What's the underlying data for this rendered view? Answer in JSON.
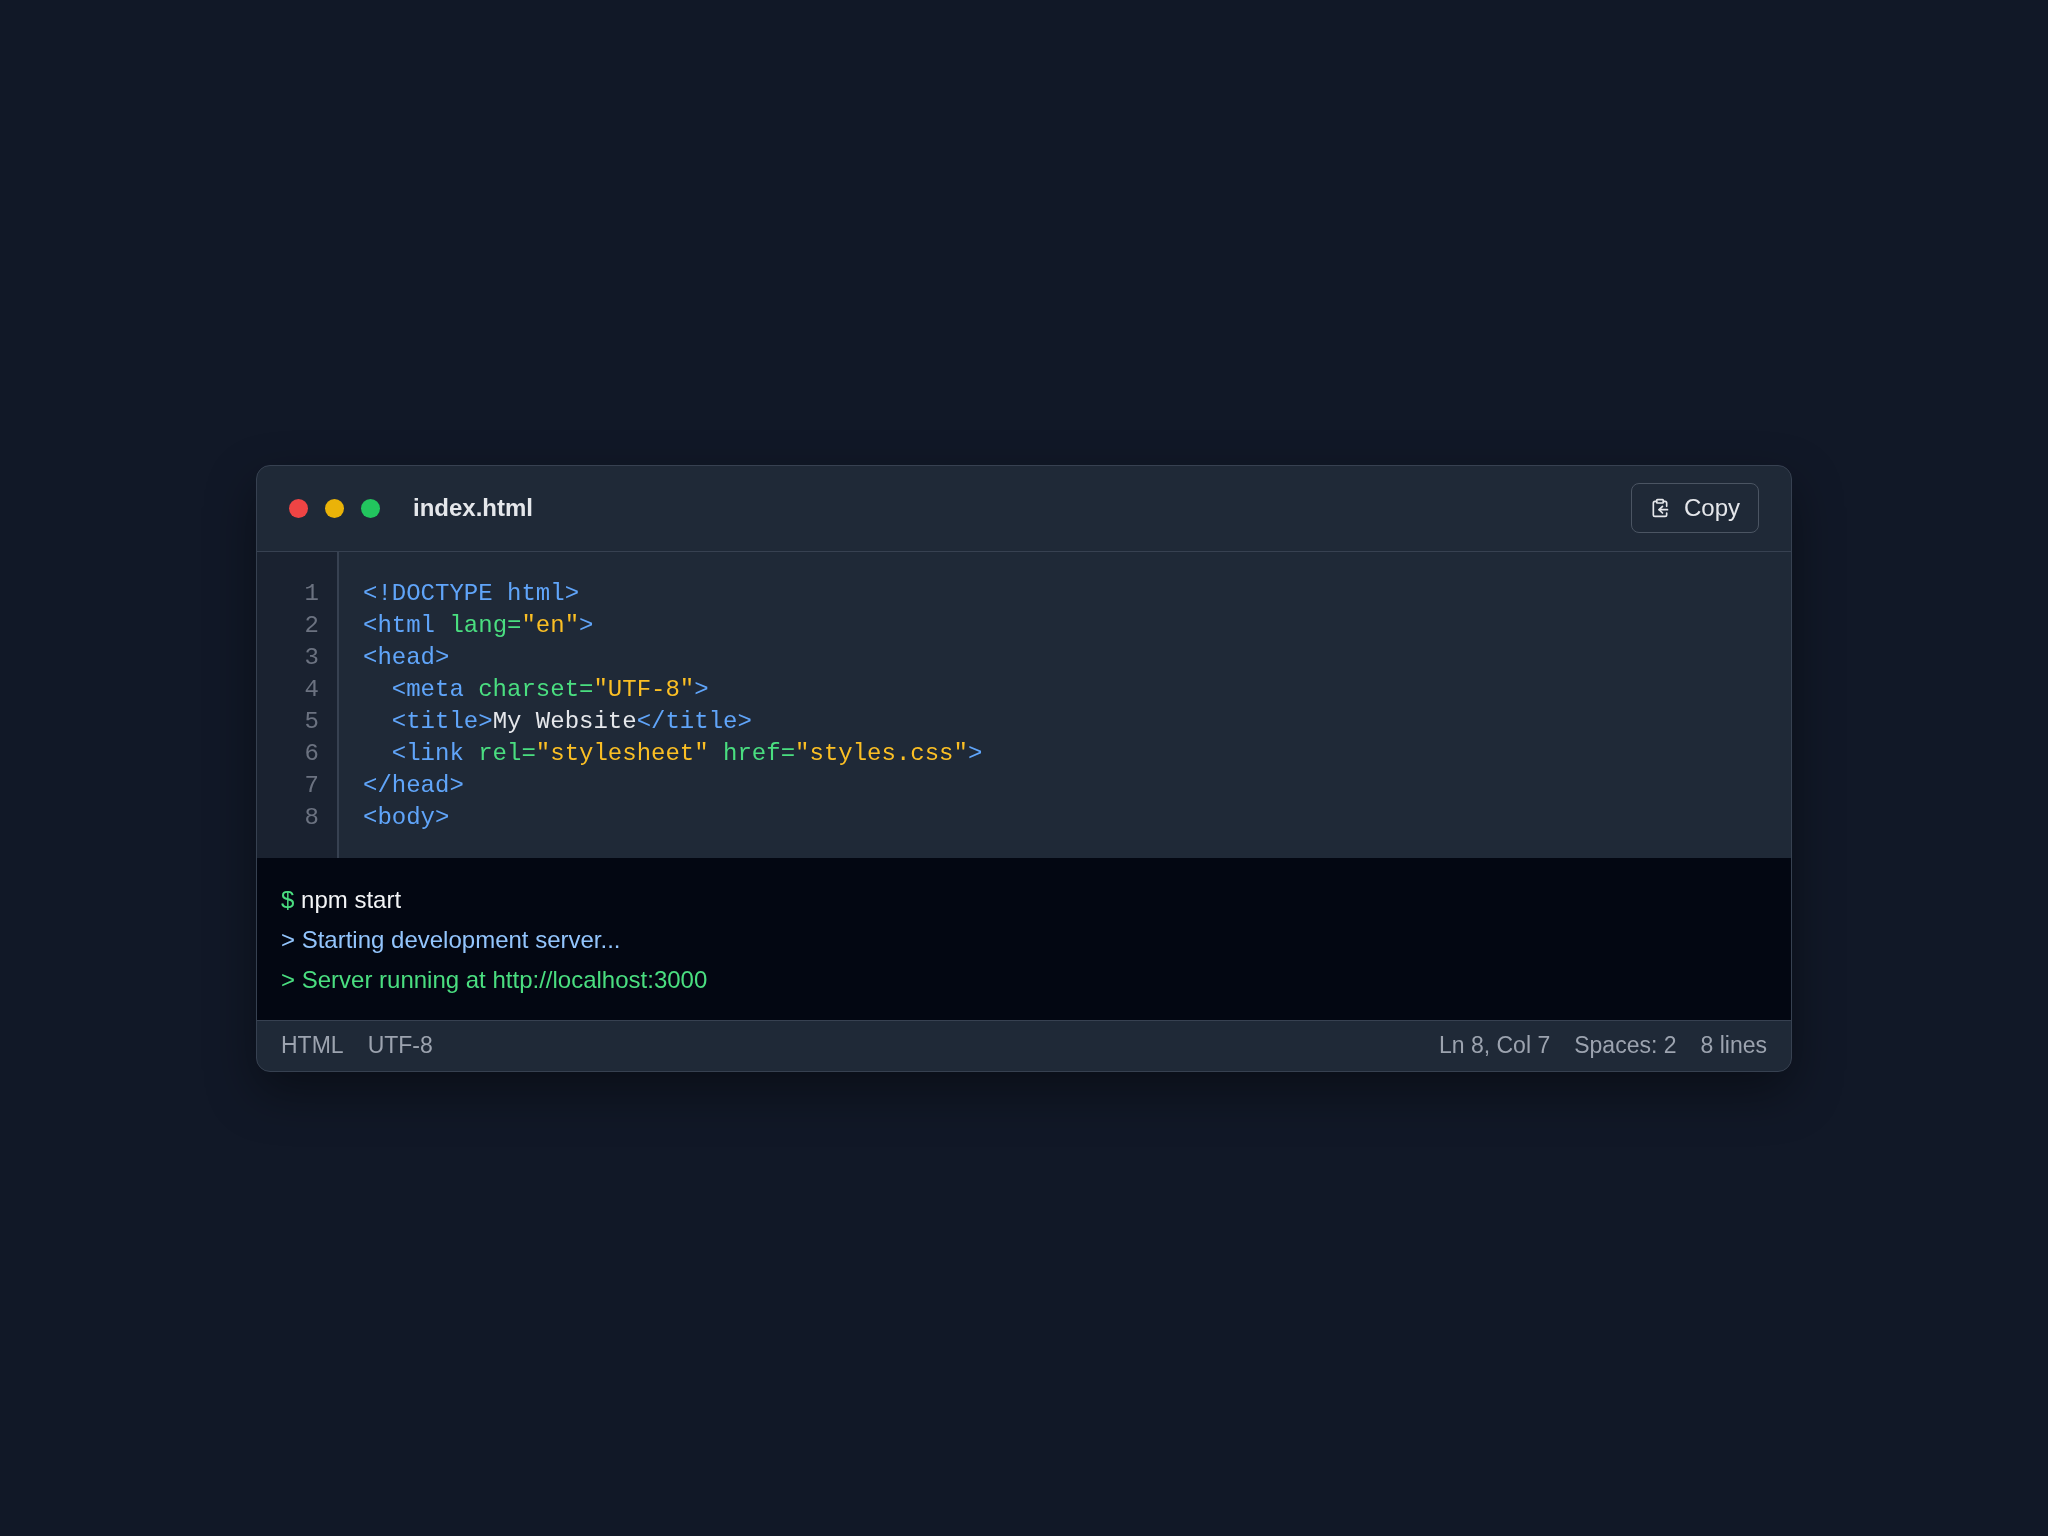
{
  "window": {
    "title": "index.html",
    "copy_button": "Copy"
  },
  "code": {
    "lines": [
      {
        "number": "1",
        "tokens": [
          {
            "kind": "tag",
            "text": "<!DOCTYPE html>"
          }
        ]
      },
      {
        "number": "2",
        "tokens": [
          {
            "kind": "tag",
            "text": "<html "
          },
          {
            "kind": "attr",
            "text": "lang="
          },
          {
            "kind": "string",
            "text": "\"en\""
          },
          {
            "kind": "tag",
            "text": ">"
          }
        ]
      },
      {
        "number": "3",
        "tokens": [
          {
            "kind": "tag",
            "text": "<head>"
          }
        ]
      },
      {
        "number": "4",
        "tokens": [
          {
            "kind": "tag",
            "text": "  <meta "
          },
          {
            "kind": "attr",
            "text": "charset="
          },
          {
            "kind": "string",
            "text": "\"UTF-8\""
          },
          {
            "kind": "tag",
            "text": ">"
          }
        ]
      },
      {
        "number": "5",
        "tokens": [
          {
            "kind": "tag",
            "text": "  <title>"
          },
          {
            "kind": "text",
            "text": "My Website"
          },
          {
            "kind": "tag",
            "text": "</title>"
          }
        ]
      },
      {
        "number": "6",
        "tokens": [
          {
            "kind": "tag",
            "text": "  <link "
          },
          {
            "kind": "attr",
            "text": "rel="
          },
          {
            "kind": "string",
            "text": "\"stylesheet\" "
          },
          {
            "kind": "attr",
            "text": "href="
          },
          {
            "kind": "string",
            "text": "\"styles.css\""
          },
          {
            "kind": "tag",
            "text": ">"
          }
        ]
      },
      {
        "number": "7",
        "tokens": [
          {
            "kind": "tag",
            "text": "</head>"
          }
        ]
      },
      {
        "number": "8",
        "tokens": [
          {
            "kind": "tag",
            "text": "<body>"
          }
        ]
      }
    ]
  },
  "terminal": {
    "lines": [
      {
        "kind": "command",
        "prompt": "$",
        "text": "npm start"
      },
      {
        "kind": "info",
        "text": "> Starting development server..."
      },
      {
        "kind": "success",
        "text": "> Server running at http://localhost:3000"
      }
    ]
  },
  "status_bar": {
    "left": [
      "HTML",
      "UTF-8"
    ],
    "right": [
      "Ln 8, Col 7",
      "Spaces: 2",
      "8 lines"
    ]
  }
}
